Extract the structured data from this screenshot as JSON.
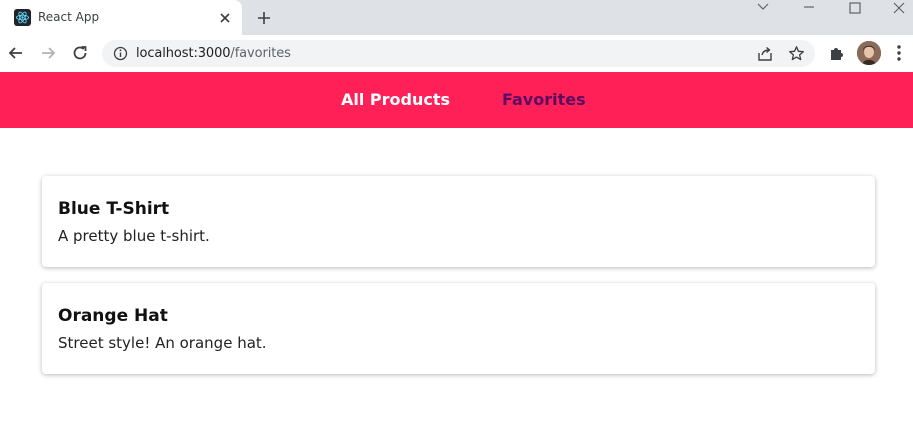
{
  "browser": {
    "tab_title": "React App",
    "url_host": "localhost:3000",
    "url_path": "/favorites"
  },
  "nav": {
    "all_products": "All Products",
    "favorites": "Favorites",
    "active": "favorites"
  },
  "products": [
    {
      "title": "Blue T-Shirt",
      "description": "A pretty blue t-shirt."
    },
    {
      "title": "Orange Hat",
      "description": "Street style! An orange hat."
    }
  ],
  "colors": {
    "nav_background": "#ff2058",
    "nav_link": "#ffffff",
    "nav_link_active": "#5d0b62"
  },
  "icons": [
    "react-favicon-icon",
    "close-icon",
    "plus-icon",
    "back-arrow-icon",
    "forward-arrow-icon",
    "reload-icon",
    "info-icon",
    "share-icon",
    "star-icon",
    "puzzle-icon",
    "kebab-menu-icon",
    "minimize-icon",
    "maximize-icon",
    "chevron-down-icon"
  ]
}
